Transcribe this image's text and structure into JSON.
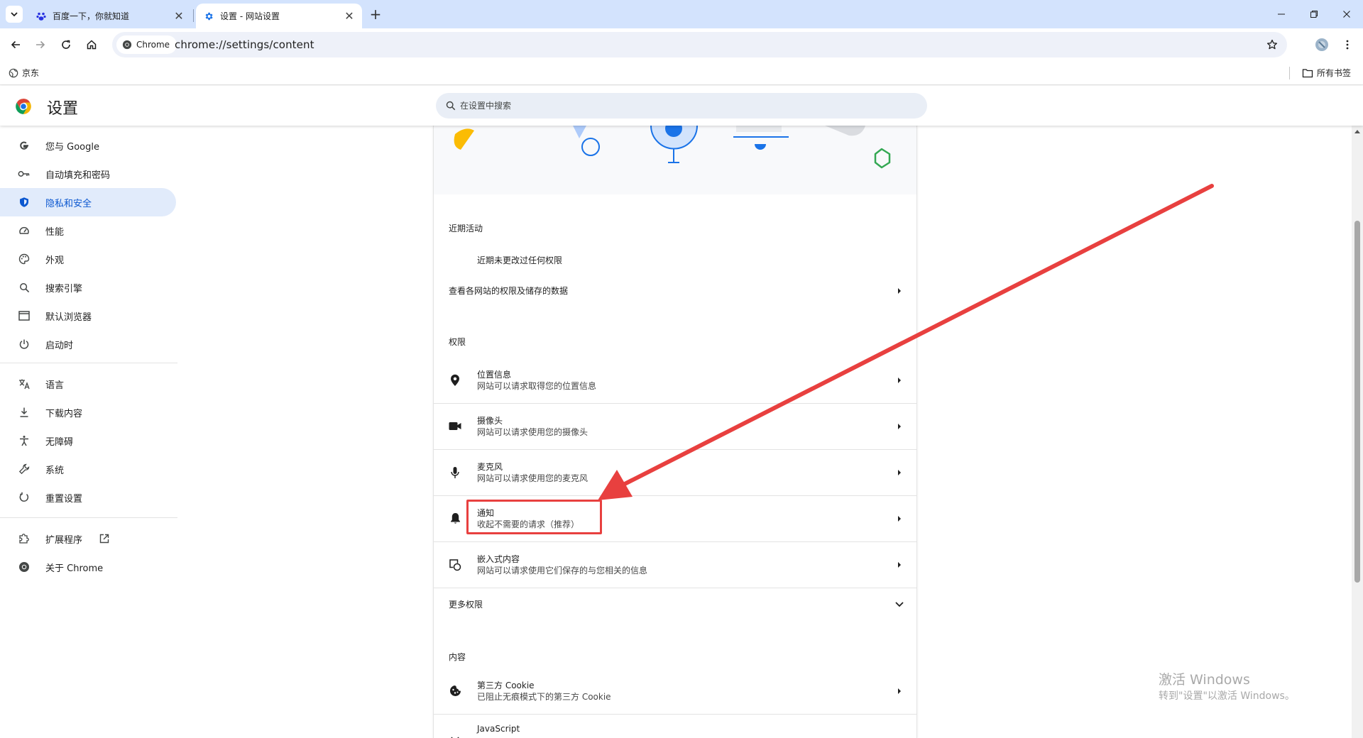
{
  "tabs": [
    {
      "title": "百度一下，你就知道",
      "active": false
    },
    {
      "title": "设置 - 网站设置",
      "active": true
    }
  ],
  "toolbar": {
    "site_chip": "Chrome",
    "url": "chrome://settings/content"
  },
  "bookmarks": {
    "left_item": "京东",
    "right_item": "所有书签"
  },
  "header": {
    "title": "设置",
    "search_placeholder": "在设置中搜索"
  },
  "sidebar": {
    "items": [
      {
        "label": "您与 Google",
        "icon": "google-g-icon"
      },
      {
        "label": "自动填充和密码",
        "icon": "key-icon"
      },
      {
        "label": "隐私和安全",
        "icon": "shield-icon",
        "selected": true
      },
      {
        "label": "性能",
        "icon": "speedometer-icon"
      },
      {
        "label": "外观",
        "icon": "palette-icon"
      },
      {
        "label": "搜索引擎",
        "icon": "search-icon"
      },
      {
        "label": "默认浏览器",
        "icon": "browser-window-icon"
      },
      {
        "label": "启动时",
        "icon": "power-icon"
      },
      {
        "label": "语言",
        "icon": "translate-icon"
      },
      {
        "label": "下载内容",
        "icon": "download-icon"
      },
      {
        "label": "无障碍",
        "icon": "accessibility-icon"
      },
      {
        "label": "系统",
        "icon": "wrench-icon"
      },
      {
        "label": "重置设置",
        "icon": "reset-icon"
      },
      {
        "label": "扩展程序",
        "icon": "puzzle-icon"
      },
      {
        "label": "关于 Chrome",
        "icon": "chrome-icon"
      }
    ]
  },
  "content": {
    "recent_activity_label": "近期活动",
    "recent_activity_empty": "近期未更改过任何权限",
    "view_permissions_row": "查看各网站的权限及储存的数据",
    "permissions_label": "权限",
    "permissions": [
      {
        "title": "位置信息",
        "subtitle": "网站可以请求取得您的位置信息",
        "icon": "location-pin-icon"
      },
      {
        "title": "摄像头",
        "subtitle": "网站可以请求使用您的摄像头",
        "icon": "camera-icon"
      },
      {
        "title": "麦克风",
        "subtitle": "网站可以请求使用您的麦克风",
        "icon": "microphone-icon"
      },
      {
        "title": "通知",
        "subtitle": "收起不需要的请求（推荐）",
        "icon": "bell-icon"
      },
      {
        "title": "嵌入式内容",
        "subtitle": "网站可以请求使用它们保存的与您相关的信息",
        "icon": "embedded-content-icon"
      }
    ],
    "more_permissions": "更多权限",
    "content_label": "内容",
    "content_items": [
      {
        "title": "第三方 Cookie",
        "subtitle": "已阻止无痕模式下的第三方 Cookie",
        "icon": "cookie-icon"
      },
      {
        "title": "JavaScript",
        "subtitle": "",
        "icon": "code-icon"
      }
    ]
  },
  "watermark": {
    "line1": "激活 Windows",
    "line2": "转到\"设置\"以激活 Windows。"
  },
  "colors": {
    "accent": "#0b57d0",
    "tabstrip": "#d3e3fd",
    "selected_nav": "#e1ebfb",
    "annotation": "#e8403f"
  }
}
